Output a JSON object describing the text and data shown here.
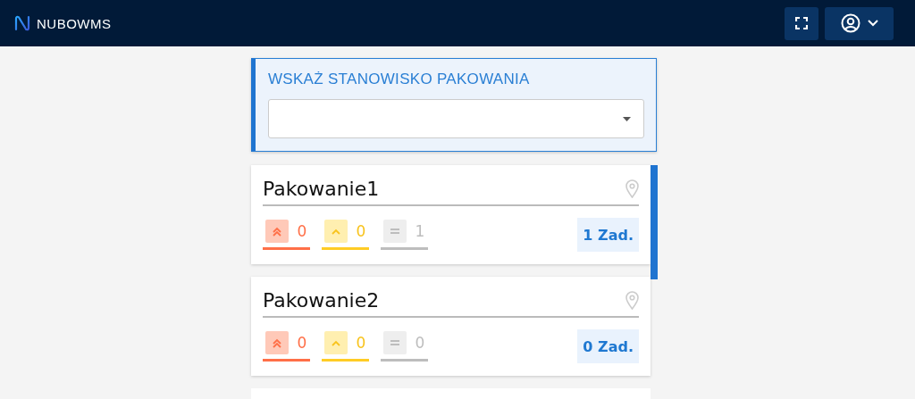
{
  "header": {
    "logo": "NUBO**WMS**"
  },
  "station_picker": {
    "title": "WSKAŻ STANOWISKO PAKOWANIA"
  },
  "stations": [
    {
      "name": "Pakowanie1",
      "counters": [
        {
          "kind": "high",
          "count": "0"
        },
        {
          "kind": "medium",
          "count": "0"
        },
        {
          "kind": "low",
          "count": "1"
        }
      ],
      "tasks": "1 Zad."
    },
    {
      "name": "Pakowanie2",
      "counters": [
        {
          "kind": "high",
          "count": "0"
        },
        {
          "kind": "medium",
          "count": "0"
        },
        {
          "kind": "low",
          "count": "0"
        }
      ],
      "tasks": "0 Zad."
    }
  ]
}
